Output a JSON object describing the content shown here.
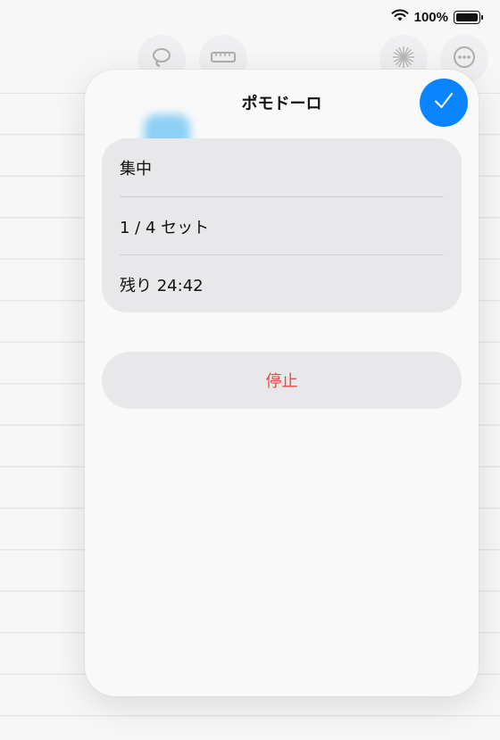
{
  "status_bar": {
    "battery_text": "100%"
  },
  "sheet": {
    "title": "ポモドーロ",
    "rows": [
      {
        "label": "集中"
      },
      {
        "label": "1 / 4 セット"
      },
      {
        "label": "残り 24:42"
      }
    ],
    "stop_label": "停止"
  },
  "icons": {
    "wifi": "wifi-icon",
    "battery": "battery-icon",
    "done": "checkmark-icon",
    "lasso": "lasso-icon",
    "ruler": "ruler-icon",
    "sparkle": "sparkle-icon",
    "more": "ellipsis-icon"
  },
  "colors": {
    "accent": "#0a84ff",
    "destructive": "#e5483e",
    "group_bg": "#e8e8ea",
    "sheet_bg": "#f9f9fa"
  }
}
